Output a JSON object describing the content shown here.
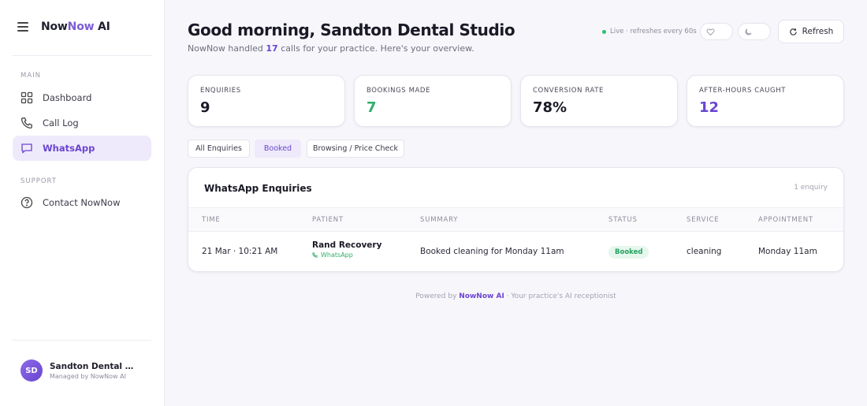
{
  "brand": {
    "part1": "Now",
    "part2": "Now",
    "part3": " AI"
  },
  "sidebar": {
    "main_label": "MAIN",
    "support_label": "SUPPORT",
    "items": [
      {
        "label": "Dashboard",
        "icon": "grid-icon"
      },
      {
        "label": "Call Log",
        "icon": "phone-icon"
      },
      {
        "label": "WhatsApp",
        "icon": "chat-icon",
        "active": true
      },
      {
        "label": "Contact NowNow",
        "icon": "help-icon"
      }
    ],
    "user": {
      "initials": "SD",
      "name": "Sandton Dental Stu...",
      "sub": "Managed by NowNow AI"
    }
  },
  "header": {
    "title": "Good morning, Sandton Dental Studio",
    "subtitle_pre": "NowNow handled ",
    "subtitle_count": "17",
    "subtitle_post": " calls for your practice. Here's your overview.",
    "live_text": "Live · refreshes every 60s",
    "refresh_label": "Refresh"
  },
  "stats": [
    {
      "label": "ENQUIRIES",
      "value": "9",
      "color": "#1a1a26"
    },
    {
      "label": "BOOKINGS MADE",
      "value": "7",
      "color": "#2fae6a"
    },
    {
      "label": "CONVERSION RATE",
      "value": "78%",
      "color": "#1a1a26"
    },
    {
      "label": "AFTER-HOURS CAUGHT",
      "value": "12",
      "color": "#6a45d0"
    }
  ],
  "filters": [
    "All Enquiries",
    "Booked",
    "Browsing / Price Check"
  ],
  "table": {
    "title": "WhatsApp Enquiries",
    "count": "1 enquiry",
    "columns": [
      "TIME",
      "PATIENT",
      "SUMMARY",
      "STATUS",
      "SERVICE",
      "APPOINTMENT"
    ],
    "rows": [
      {
        "time": "21 Mar · 10:21 AM",
        "patient": "Rand Recovery",
        "source": "WhatsApp",
        "summary": "Booked cleaning for Monday 11am",
        "status": "Booked",
        "service": "cleaning",
        "appointment": "Monday 11am"
      }
    ]
  },
  "footer": {
    "pre": "Powered by ",
    "brand": "NowNow AI",
    "post": " · Your practice's AI receptionist"
  }
}
